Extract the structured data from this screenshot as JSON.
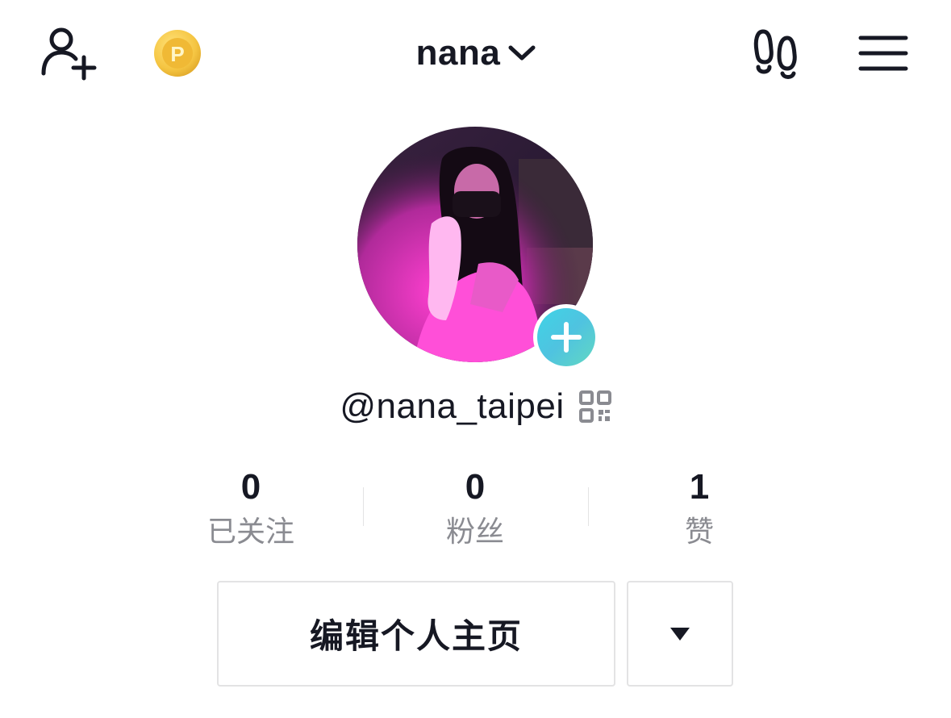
{
  "header": {
    "title": "nana",
    "icons": {
      "left_1": "add-friend-icon",
      "left_2": "coin-icon",
      "right_1": "footprints-icon",
      "right_2": "menu-icon"
    }
  },
  "profile": {
    "username": "@nana_taipei",
    "avatar_add": "add-icon",
    "qr": "qr-code-icon"
  },
  "stats": [
    {
      "value": "0",
      "label": "已关注"
    },
    {
      "value": "0",
      "label": "粉丝"
    },
    {
      "value": "1",
      "label": "赞"
    }
  ],
  "actions": {
    "edit_label": "编辑个人主页",
    "more": "dropdown-arrow-icon"
  },
  "colors": {
    "text": "#161823",
    "muted": "#8a8b91",
    "border": "#e3e3e4",
    "accent_gradient_start": "#3fd4e6",
    "accent_gradient_end": "#62d8c2",
    "coin": "#f5c542"
  }
}
